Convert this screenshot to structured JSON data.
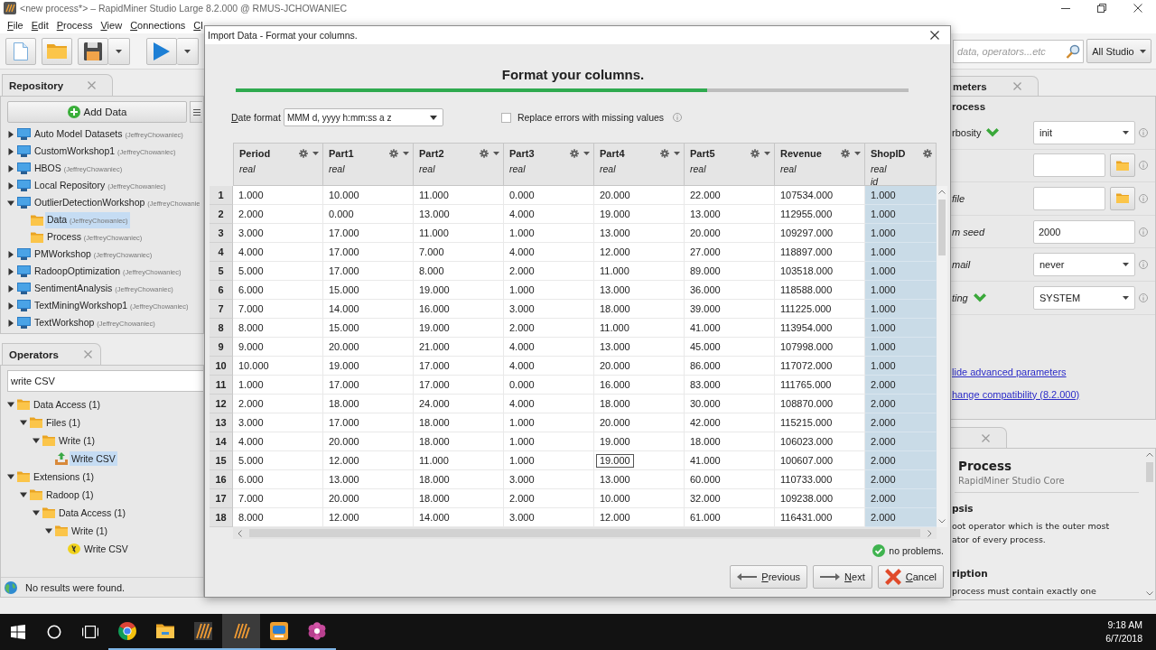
{
  "window": {
    "title": "<new process*> – RapidMiner Studio Large 8.2.000 @ RMUS-JCHOWANIEC",
    "controls": [
      {
        "kind": "minimize"
      },
      {
        "kind": "restore"
      },
      {
        "kind": "close"
      }
    ]
  },
  "menu": [
    "File",
    "Edit",
    "Process",
    "View",
    "Connections",
    "Cl"
  ],
  "toolbar": {
    "buttons": [
      {
        "kind": "new",
        "dropdown": false
      },
      {
        "kind": "open",
        "dropdown": false
      },
      {
        "kind": "save",
        "dropdown": true
      },
      {
        "kind": "run",
        "dropdown": true
      }
    ],
    "search": {
      "placeholder": "data, operators...etc"
    },
    "scope": "All Studio"
  },
  "repository": {
    "tab": "Repository",
    "add_button": "Add Data",
    "items": [
      {
        "name": "Auto Model Datasets",
        "owner": "(JeffreyChowaniec)",
        "kind": "repo",
        "expanded": false,
        "selected": false
      },
      {
        "name": "CustomWorkshop1",
        "owner": "(JeffreyChowaniec)",
        "kind": "repo",
        "expanded": false,
        "selected": false
      },
      {
        "name": "HBOS",
        "owner": "(JeffreyChowaniec)",
        "kind": "repo",
        "expanded": false,
        "selected": false
      },
      {
        "name": "Local Repository",
        "owner": "(JeffreyChowaniec)",
        "kind": "repo",
        "expanded": false,
        "selected": false
      },
      {
        "name": "OutlierDetectionWorkshop",
        "owner": "(JeffreyChowanie",
        "kind": "repo",
        "expanded": true,
        "selected": false,
        "children": [
          {
            "name": "Data",
            "owner": "(JeffreyChowaniec)",
            "kind": "folder",
            "selected": true
          },
          {
            "name": "Process",
            "owner": "(JeffreyChowaniec)",
            "kind": "folder",
            "selected": false
          }
        ]
      },
      {
        "name": "PMWorkshop",
        "owner": "(JeffreyChowaniec)",
        "kind": "repo",
        "expanded": false,
        "selected": false
      },
      {
        "name": "RadoopOptimization",
        "owner": "(JeffreyChowaniec)",
        "kind": "repo",
        "expanded": false,
        "selected": false
      },
      {
        "name": "SentimentAnalysis",
        "owner": "(JeffreyChowaniec)",
        "kind": "repo",
        "expanded": false,
        "selected": false
      },
      {
        "name": "TextMiningWorkshop1",
        "owner": "(JeffreyChowaniec)",
        "kind": "repo",
        "expanded": false,
        "selected": false
      },
      {
        "name": "TextWorkshop",
        "owner": "(JeffreyChowaniec)",
        "kind": "repo",
        "expanded": false,
        "selected": false
      }
    ]
  },
  "operators": {
    "tab": "Operators",
    "search": {
      "value": "write CSV"
    },
    "items": [
      {
        "name": "Data Access (1)",
        "kind": "folder",
        "expanded": true,
        "selected": false,
        "children": [
          {
            "name": "Files (1)",
            "kind": "folder",
            "expanded": true,
            "selected": false,
            "children": [
              {
                "name": "Write (1)",
                "kind": "folder",
                "expanded": true,
                "selected": false,
                "children": [
                  {
                    "name": "Write CSV",
                    "kind": "operator",
                    "selected": true
                  }
                ]
              }
            ]
          }
        ]
      },
      {
        "name": "Extensions (1)",
        "kind": "folder",
        "expanded": true,
        "selected": false,
        "children": [
          {
            "name": "Radoop (1)",
            "kind": "folder",
            "expanded": true,
            "selected": false,
            "children": [
              {
                "name": "Data Access (1)",
                "kind": "folder",
                "expanded": true,
                "selected": false,
                "children": [
                  {
                    "name": "Write (1)",
                    "kind": "folder",
                    "expanded": true,
                    "selected": false,
                    "children": [
                      {
                        "name": "Write CSV",
                        "kind": "radoop",
                        "selected": false
                      }
                    ]
                  }
                ]
              }
            ]
          }
        ]
      }
    ],
    "status": "No results were found."
  },
  "dialog": {
    "title": "Import Data - Format your columns.",
    "heading": "Format your columns.",
    "progress": {
      "level": 0.7
    },
    "date_format": {
      "label": "Date format",
      "value": "MMM d, yyyy h:mm:ss a z"
    },
    "replace_errors": {
      "label": "Replace errors with missing values",
      "checked": false
    },
    "table": {
      "columns": [
        {
          "name": "Period",
          "type": "real",
          "highlighted": false,
          "dropdown": true
        },
        {
          "name": "Part1",
          "type": "real",
          "highlighted": false,
          "dropdown": true
        },
        {
          "name": "Part2",
          "type": "real",
          "highlighted": false,
          "dropdown": true
        },
        {
          "name": "Part3",
          "type": "real",
          "highlighted": false,
          "dropdown": true
        },
        {
          "name": "Part4",
          "type": "real",
          "highlighted": false,
          "dropdown": true
        },
        {
          "name": "Part5",
          "type": "real",
          "highlighted": false,
          "dropdown": true
        },
        {
          "name": "Revenue",
          "type": "real",
          "highlighted": false,
          "dropdown": true
        },
        {
          "name": "ShopID",
          "type": "real",
          "role": "id",
          "highlighted": true,
          "dropdown": false
        }
      ],
      "rows": [
        {
          "number": "1",
          "cells": [
            "1.000",
            "10.000",
            "11.000",
            "0.000",
            "20.000",
            "22.000",
            "107534.000",
            "1.000"
          ]
        },
        {
          "number": "2",
          "cells": [
            "2.000",
            "0.000",
            "13.000",
            "4.000",
            "19.000",
            "13.000",
            "112955.000",
            "1.000"
          ]
        },
        {
          "number": "3",
          "cells": [
            "3.000",
            "17.000",
            "11.000",
            "1.000",
            "13.000",
            "20.000",
            "109297.000",
            "1.000"
          ]
        },
        {
          "number": "4",
          "cells": [
            "4.000",
            "17.000",
            "7.000",
            "4.000",
            "12.000",
            "27.000",
            "118897.000",
            "1.000"
          ]
        },
        {
          "number": "5",
          "cells": [
            "5.000",
            "17.000",
            "8.000",
            "2.000",
            "11.000",
            "89.000",
            "103518.000",
            "1.000"
          ]
        },
        {
          "number": "6",
          "cells": [
            "6.000",
            "15.000",
            "19.000",
            "1.000",
            "13.000",
            "36.000",
            "118588.000",
            "1.000"
          ]
        },
        {
          "number": "7",
          "cells": [
            "7.000",
            "14.000",
            "16.000",
            "3.000",
            "18.000",
            "39.000",
            "111225.000",
            "1.000"
          ]
        },
        {
          "number": "8",
          "cells": [
            "8.000",
            "15.000",
            "19.000",
            "2.000",
            "11.000",
            "41.000",
            "113954.000",
            "1.000"
          ]
        },
        {
          "number": "9",
          "cells": [
            "9.000",
            "20.000",
            "21.000",
            "4.000",
            "13.000",
            "45.000",
            "107998.000",
            "1.000"
          ]
        },
        {
          "number": "10",
          "cells": [
            "10.000",
            "19.000",
            "17.000",
            "4.000",
            "20.000",
            "86.000",
            "117072.000",
            "1.000"
          ]
        },
        {
          "number": "11",
          "cells": [
            "1.000",
            "17.000",
            "17.000",
            "0.000",
            "16.000",
            "83.000",
            "111765.000",
            "2.000"
          ]
        },
        {
          "number": "12",
          "cells": [
            "2.000",
            "18.000",
            "24.000",
            "4.000",
            "18.000",
            "30.000",
            "108870.000",
            "2.000"
          ]
        },
        {
          "number": "13",
          "cells": [
            "3.000",
            "17.000",
            "18.000",
            "1.000",
            "20.000",
            "42.000",
            "115215.000",
            "2.000"
          ]
        },
        {
          "number": "14",
          "cells": [
            "4.000",
            "20.000",
            "18.000",
            "1.000",
            "19.000",
            "18.000",
            "106023.000",
            "2.000"
          ]
        },
        {
          "number": "15",
          "cells": [
            "5.000",
            "12.000",
            "11.000",
            "1.000",
            {
              "text": "19.000",
              "outlined": true
            },
            "41.000",
            "100607.000",
            "2.000"
          ]
        },
        {
          "number": "16",
          "cells": [
            "6.000",
            "13.000",
            "18.000",
            "3.000",
            "13.000",
            "60.000",
            "110733.000",
            "2.000"
          ]
        },
        {
          "number": "17",
          "cells": [
            "7.000",
            "20.000",
            "18.000",
            "2.000",
            "10.000",
            "32.000",
            "109238.000",
            "2.000"
          ]
        },
        {
          "number": "18",
          "cells": [
            "8.000",
            "12.000",
            "14.000",
            "3.000",
            "12.000",
            "61.000",
            "116431.000",
            "2.000"
          ]
        }
      ]
    },
    "status": "no problems.",
    "buttons": [
      {
        "kind": "previous",
        "label": "Previous"
      },
      {
        "kind": "next",
        "label": "Next"
      },
      {
        "kind": "cancel",
        "label": "Cancel"
      }
    ]
  },
  "parameters": {
    "tab": "meters",
    "section": "rocess",
    "rows": [
      {
        "label": "rbosity",
        "kind": "select",
        "value": "init",
        "marked": true,
        "optional": false
      },
      {
        "kind": "file",
        "marked": false
      },
      {
        "label": "file",
        "kind": "file",
        "marked": false,
        "optional": true
      },
      {
        "label": "m seed",
        "kind": "text",
        "value": "2000",
        "marked": false,
        "optional": true
      },
      {
        "label": "mail",
        "kind": "select",
        "value": "never",
        "marked": false,
        "optional": true
      },
      {
        "label": "ting",
        "kind": "select",
        "value": "SYSTEM",
        "marked": true,
        "optional": true
      }
    ],
    "links": [
      "lide advanced parameters",
      "hange compatibility (8.2.000)"
    ]
  },
  "help": {
    "title": "Process",
    "subtitle": "RapidMiner Studio Core",
    "sections": [
      {
        "heading": "psis",
        "lines": [
          "oot operator which is the outer most",
          "ator of every process."
        ]
      },
      {
        "heading": "ription",
        "lines": [
          "process must contain exactly one"
        ]
      }
    ]
  },
  "taskbar": {
    "items": [
      {
        "kind": "start",
        "open": false,
        "active": false
      },
      {
        "kind": "search",
        "open": false,
        "active": false
      },
      {
        "kind": "taskview",
        "open": false,
        "active": false
      },
      {
        "kind": "browser",
        "open": true,
        "active": false
      },
      {
        "kind": "files",
        "open": true,
        "active": false
      },
      {
        "kind": "rapidminer",
        "open": true,
        "active": false
      },
      {
        "kind": "rapidminer",
        "open": true,
        "active": true
      },
      {
        "kind": "recorder",
        "open": true,
        "active": false
      },
      {
        "kind": "flower",
        "open": true,
        "active": false
      }
    ],
    "time": "9:18 AM",
    "date": "6/7/2018"
  }
}
